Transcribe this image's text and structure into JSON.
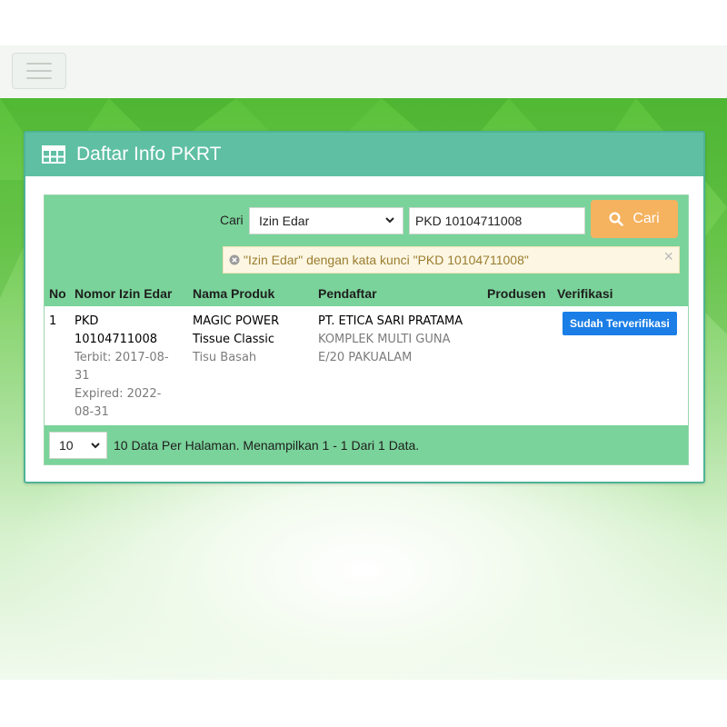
{
  "header": {
    "menu_icon": "hamburger-icon"
  },
  "panel": {
    "title": "Daftar Info PKRT",
    "icon": "table-icon"
  },
  "search": {
    "label": "Cari",
    "field_selected": "Izin Edar",
    "query": "PKD 10104711008",
    "button_label": "Cari",
    "button_icon": "search-icon",
    "alert_text": "\"Izin Edar\" dengan kata kunci \"PKD 10104711008\"",
    "alert_close": "×"
  },
  "table": {
    "columns": [
      "No",
      "Nomor Izin Edar",
      "Nama Produk",
      "Pendaftar",
      "Produsen",
      "Verifikasi"
    ],
    "rows": [
      {
        "no": "1",
        "nomor_l1": "PKD",
        "nomor_l2": "10104711008",
        "terbit_l1": "Terbit: 2017-08-",
        "terbit_l2": "31",
        "expired_l1": "Expired: 2022-",
        "expired_l2": "08-31",
        "produk_l1": "MAGIC POWER",
        "produk_l2": "Tissue Classic",
        "produk_jenis": "Tisu Basah",
        "pendaftar_nama": "PT. ETICA SARI PRATAMA",
        "pendaftar_alamat_l1": "KOMPLEK MULTI GUNA",
        "pendaftar_alamat_l2": "E/20 PAKUALAM",
        "produsen": "",
        "verifikasi": "Sudah Terverifikasi"
      }
    ]
  },
  "pager": {
    "per_page": "10",
    "summary": "10 Data Per Halaman. Menampilkan 1 - 1 Dari 1 Data."
  },
  "colors": {
    "header_teal": "#5fbfa3",
    "table_green": "#7ad39a",
    "search_button": "#f5b25f",
    "verified_badge": "#1a7ee6"
  }
}
